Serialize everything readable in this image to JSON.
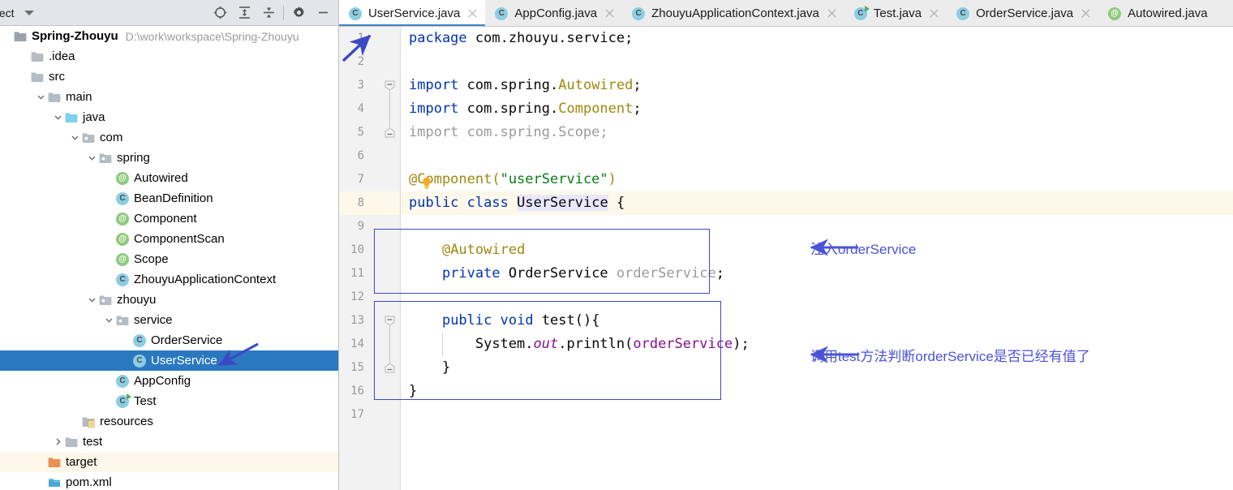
{
  "toolwindow": {
    "title": "oject",
    "title_full": "Project",
    "dropdown_icon": "chevron-down-icon",
    "icons": [
      {
        "name": "locate-icon",
        "label": "Select Opened File"
      },
      {
        "name": "expand-all-icon",
        "label": "Expand All"
      },
      {
        "name": "collapse-all-icon",
        "label": "Collapse All"
      },
      {
        "name": "gear-icon",
        "label": "Settings"
      },
      {
        "name": "minimize-icon",
        "label": "Hide"
      }
    ]
  },
  "tree": {
    "items": [
      {
        "label": "Spring-Zhouyu",
        "path": "D:\\work\\workspace\\Spring-Zhouyu",
        "indent": 0,
        "icon": "project-root-icon",
        "twisty": "none",
        "bold": true,
        "selected": false,
        "cream": false
      },
      {
        "label": ".idea",
        "path": "",
        "indent": 1,
        "icon": "folder-icon",
        "twisty": "none",
        "bold": false,
        "selected": false,
        "cream": false
      },
      {
        "label": "src",
        "path": "",
        "indent": 1,
        "icon": "folder-icon",
        "twisty": "none",
        "bold": false,
        "selected": false,
        "cream": false
      },
      {
        "label": "main",
        "path": "",
        "indent": 2,
        "icon": "folder-icon",
        "twisty": "expanded",
        "bold": false,
        "selected": false,
        "cream": false
      },
      {
        "label": "java",
        "path": "",
        "indent": 3,
        "icon": "source-folder-icon",
        "twisty": "expanded",
        "bold": false,
        "selected": false,
        "cream": false
      },
      {
        "label": "com",
        "path": "",
        "indent": 4,
        "icon": "package-icon",
        "twisty": "expanded",
        "bold": false,
        "selected": false,
        "cream": false
      },
      {
        "label": "spring",
        "path": "",
        "indent": 5,
        "icon": "package-icon",
        "twisty": "expanded",
        "bold": false,
        "selected": false,
        "cream": false
      },
      {
        "label": "Autowired",
        "path": "",
        "indent": 6,
        "icon": "annotation-icon",
        "twisty": "none",
        "bold": false,
        "selected": false,
        "cream": false
      },
      {
        "label": "BeanDefinition",
        "path": "",
        "indent": 6,
        "icon": "class-icon",
        "twisty": "none",
        "bold": false,
        "selected": false,
        "cream": false
      },
      {
        "label": "Component",
        "path": "",
        "indent": 6,
        "icon": "annotation-icon",
        "twisty": "none",
        "bold": false,
        "selected": false,
        "cream": false
      },
      {
        "label": "ComponentScan",
        "path": "",
        "indent": 6,
        "icon": "annotation-icon",
        "twisty": "none",
        "bold": false,
        "selected": false,
        "cream": false
      },
      {
        "label": "Scope",
        "path": "",
        "indent": 6,
        "icon": "annotation-icon",
        "twisty": "none",
        "bold": false,
        "selected": false,
        "cream": false
      },
      {
        "label": "ZhouyuApplicationContext",
        "path": "",
        "indent": 6,
        "icon": "class-icon",
        "twisty": "none",
        "bold": false,
        "selected": false,
        "cream": false
      },
      {
        "label": "zhouyu",
        "path": "",
        "indent": 5,
        "icon": "package-icon",
        "twisty": "expanded",
        "bold": false,
        "selected": false,
        "cream": false
      },
      {
        "label": "service",
        "path": "",
        "indent": 6,
        "icon": "package-icon",
        "twisty": "expanded",
        "bold": false,
        "selected": false,
        "cream": false
      },
      {
        "label": "OrderService",
        "path": "",
        "indent": 7,
        "icon": "class-icon",
        "twisty": "none",
        "bold": false,
        "selected": false,
        "cream": false
      },
      {
        "label": "UserService",
        "path": "",
        "indent": 7,
        "icon": "class-icon",
        "twisty": "none",
        "bold": false,
        "selected": true,
        "cream": false
      },
      {
        "label": "AppConfig",
        "path": "",
        "indent": 6,
        "icon": "class-icon",
        "twisty": "none",
        "bold": false,
        "selected": false,
        "cream": false
      },
      {
        "label": "Test",
        "path": "",
        "indent": 6,
        "icon": "runnable-class-icon",
        "twisty": "none",
        "bold": false,
        "selected": false,
        "cream": false
      },
      {
        "label": "resources",
        "path": "",
        "indent": 4,
        "icon": "resources-folder-icon",
        "twisty": "none",
        "bold": false,
        "selected": false,
        "cream": false
      },
      {
        "label": "test",
        "path": "",
        "indent": 3,
        "icon": "folder-icon",
        "twisty": "collapsed",
        "bold": false,
        "selected": false,
        "cream": false
      },
      {
        "label": "target",
        "path": "",
        "indent": 2,
        "icon": "target-folder-icon",
        "twisty": "none",
        "bold": false,
        "selected": false,
        "cream": true
      },
      {
        "label": "pom.xml",
        "path": "",
        "indent": 2,
        "icon": "maven-icon",
        "twisty": "none",
        "bold": false,
        "selected": false,
        "cream": false
      }
    ]
  },
  "tabs": [
    {
      "label": "UserService.java",
      "icon": "class-icon",
      "active": true,
      "closable": true
    },
    {
      "label": "AppConfig.java",
      "icon": "class-icon",
      "active": false,
      "closable": true
    },
    {
      "label": "ZhouyuApplicationContext.java",
      "icon": "class-icon",
      "active": false,
      "closable": true
    },
    {
      "label": "Test.java",
      "icon": "runnable-class-icon",
      "active": false,
      "closable": true
    },
    {
      "label": "OrderService.java",
      "icon": "class-icon",
      "active": false,
      "closable": true
    },
    {
      "label": "Autowired.java",
      "icon": "annotation-icon",
      "active": false,
      "closable": false
    }
  ],
  "editor": {
    "line_numbers": [
      "1",
      "2",
      "3",
      "4",
      "5",
      "6",
      "7",
      "8",
      "9",
      "10",
      "11",
      "12",
      "13",
      "14",
      "15",
      "16",
      "17"
    ],
    "highlighted_line": 8,
    "lines": [
      {
        "n": 1,
        "tokens": [
          {
            "t": "package",
            "c": "kw"
          },
          {
            "t": " com.zhouyu.service;",
            "c": "plain"
          }
        ]
      },
      {
        "n": 2,
        "tokens": []
      },
      {
        "n": 3,
        "tokens": [
          {
            "t": "import",
            "c": "kw"
          },
          {
            "t": " com.spring.",
            "c": "plain"
          },
          {
            "t": "Autowired",
            "c": "anno"
          },
          {
            "t": ";",
            "c": "plain"
          }
        ]
      },
      {
        "n": 4,
        "tokens": [
          {
            "t": "import",
            "c": "kw"
          },
          {
            "t": " com.spring.",
            "c": "plain"
          },
          {
            "t": "Component",
            "c": "anno"
          },
          {
            "t": ";",
            "c": "plain"
          }
        ]
      },
      {
        "n": 5,
        "tokens": [
          {
            "t": "import com.spring.Scope;",
            "c": "gray"
          }
        ]
      },
      {
        "n": 6,
        "tokens": []
      },
      {
        "n": 7,
        "tokens": [
          {
            "t": "@Component(",
            "c": "anno"
          },
          {
            "t": "\"userService\"",
            "c": "str"
          },
          {
            "t": ")",
            "c": "anno"
          }
        ]
      },
      {
        "n": 8,
        "tokens": [
          {
            "t": "public",
            "c": "kw"
          },
          {
            "t": " ",
            "c": "plain"
          },
          {
            "t": "class",
            "c": "kw"
          },
          {
            "t": " ",
            "c": "plain"
          },
          {
            "t": "UserService",
            "c": "plain sel-word"
          },
          {
            "t": " {",
            "c": "plain"
          }
        ]
      },
      {
        "n": 9,
        "tokens": []
      },
      {
        "n": 10,
        "tokens": [
          {
            "t": "    ",
            "c": "plain"
          },
          {
            "t": "@Autowired",
            "c": "anno"
          }
        ]
      },
      {
        "n": 11,
        "tokens": [
          {
            "t": "    ",
            "c": "plain"
          },
          {
            "t": "private",
            "c": "kw"
          },
          {
            "t": " OrderService ",
            "c": "plain"
          },
          {
            "t": "orderService",
            "c": "gray"
          },
          {
            "t": ";",
            "c": "plain"
          }
        ]
      },
      {
        "n": 12,
        "tokens": []
      },
      {
        "n": 13,
        "tokens": [
          {
            "t": "    ",
            "c": "plain"
          },
          {
            "t": "public",
            "c": "kw"
          },
          {
            "t": " ",
            "c": "plain"
          },
          {
            "t": "void",
            "c": "kw"
          },
          {
            "t": " test(){",
            "c": "plain"
          }
        ]
      },
      {
        "n": 14,
        "tokens": [
          {
            "t": "        System.",
            "c": "plain"
          },
          {
            "t": "out",
            "c": "statfield"
          },
          {
            "t": ".println(",
            "c": "plain"
          },
          {
            "t": "orderService",
            "c": "field"
          },
          {
            "t": ");",
            "c": "plain"
          }
        ]
      },
      {
        "n": 15,
        "tokens": [
          {
            "t": "    }",
            "c": "plain"
          }
        ]
      },
      {
        "n": 16,
        "tokens": [
          {
            "t": "}",
            "c": "plain"
          }
        ]
      },
      {
        "n": 17,
        "tokens": []
      }
    ],
    "fold_lines": [
      3,
      5,
      13,
      15
    ],
    "lightbulb_line": 7
  },
  "annotations": {
    "arrow_color": "#4a52d8",
    "box_color": "#3b49c4",
    "callouts": [
      {
        "name": "inject-orderservice-note",
        "text": "注入orderService"
      },
      {
        "name": "call-test-method-note",
        "text": "调用test方法判断orderService是否已经有值了"
      }
    ]
  }
}
